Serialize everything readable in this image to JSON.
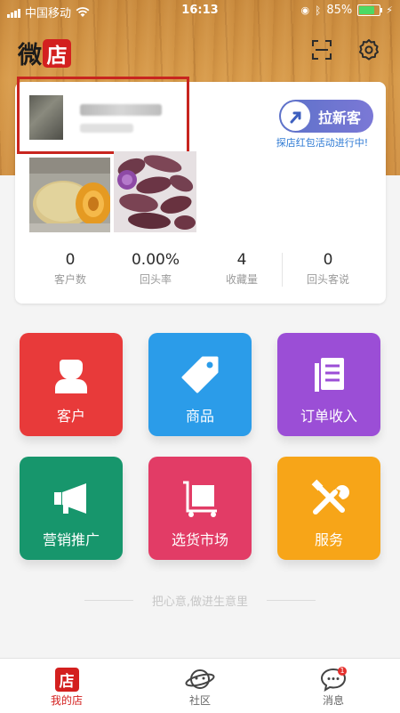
{
  "status_bar": {
    "carrier": "中国移动",
    "time": "16:13",
    "battery": "85%",
    "battery_level": 0.85
  },
  "header": {
    "logo_char1": "微",
    "logo_char2": "店",
    "scan_icon": "scan-icon",
    "settings_icon": "gear-icon"
  },
  "profile": {
    "invite_label": "拉新客",
    "promo_text": "探店红包活动进行中!"
  },
  "stats": [
    {
      "value": "0",
      "label": "客户数"
    },
    {
      "value": "0.00%",
      "label": "回头率"
    },
    {
      "value": "4",
      "label": "收藏量"
    },
    {
      "value": "0",
      "label": "回头客说"
    }
  ],
  "tiles": [
    {
      "label": "客户",
      "color": "#e83a3a",
      "icon": "person-icon"
    },
    {
      "label": "商品",
      "color": "#2b9ce9",
      "icon": "tag-icon"
    },
    {
      "label": "订单收入",
      "color": "#9b4ed6",
      "icon": "order-icon"
    },
    {
      "label": "营销推广",
      "color": "#17966c",
      "icon": "megaphone-icon"
    },
    {
      "label": "选货市场",
      "color": "#e23c66",
      "icon": "cart-icon"
    },
    {
      "label": "服务",
      "color": "#f7a518",
      "icon": "tools-icon"
    }
  ],
  "tagline": "把心意,做进生意里",
  "tabbar": {
    "tab1": "我的店",
    "tab2": "社区",
    "tab3": "消息",
    "tab1_icon_char": "店",
    "badge": "1",
    "active_color": "#d3201f"
  }
}
